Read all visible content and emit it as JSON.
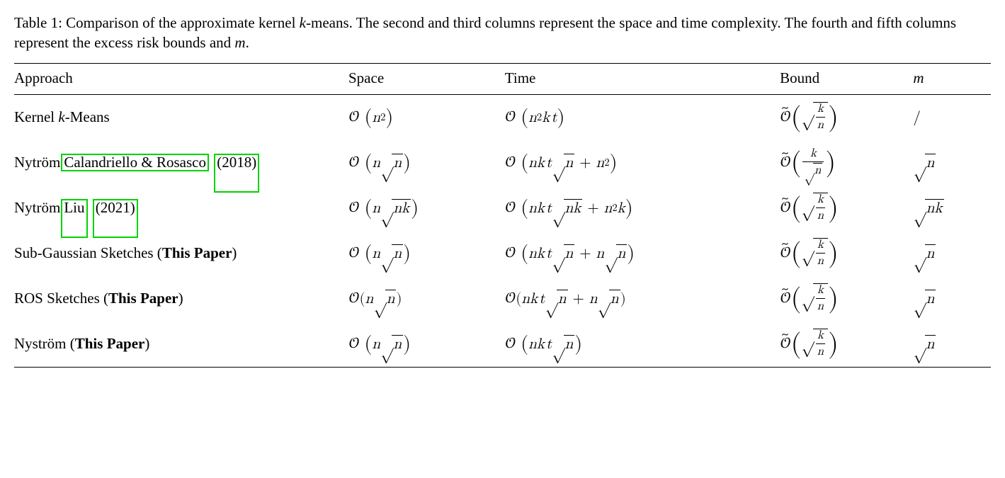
{
  "caption": {
    "label": "Table 1:",
    "text_before_k": " Comparison of the approximate kernel ",
    "k": "k",
    "text_mid": "-means. The second and third columns represent the space and time complexity. The fourth and fifth columns represent the excess risk bounds and ",
    "m": "m",
    "period": "."
  },
  "headers": {
    "approach": "Approach",
    "space": "Space",
    "time": "Time",
    "bound": "Bound",
    "m": "m"
  },
  "rows": [
    {
      "approach": {
        "prefix": "Kernel ",
        "k": "k",
        "suffix": "-Means"
      },
      "space": "O(n^2)",
      "time": "O(n^2 k t)",
      "bound": "Õ(√(k/n))",
      "m": "/"
    },
    {
      "approach": {
        "prefix": "Nytröm",
        "cite_authors": "Calandriello & Rosasco",
        "cite_year": "2018"
      },
      "space": "O(n√n)",
      "time": "O(nkt√n + n^2)",
      "bound": "Õ(k/√n)",
      "m": "√n"
    },
    {
      "approach": {
        "prefix": "Nytröm",
        "cite_authors": "Liu",
        "cite_year": "2021"
      },
      "space": "O(n√(nk))",
      "time": "O(nkt√(nk) + n^2 k)",
      "bound": "Õ(√(k/n))",
      "m": "√(nk)"
    },
    {
      "approach": {
        "prefix": "Sub-Gaussian Sketches (",
        "bold": "This Paper",
        "suffix": ")"
      },
      "space": "O(n√n)",
      "time": "O(nkt√n + n√n)",
      "bound": "Õ(√(k/n))",
      "m": "√n"
    },
    {
      "approach": {
        "prefix": "ROS Sketches (",
        "bold": "This Paper",
        "suffix": ")"
      },
      "space": "O(n√n)",
      "time": "O(nkt√n + n√n)",
      "bound": "Õ(√(k/n))",
      "m": "√n"
    },
    {
      "approach": {
        "prefix": "Nyström (",
        "bold": "This Paper",
        "suffix": ")"
      },
      "space": "O(n√n)",
      "time": "O(nkt√n)",
      "bound": "Õ(√(k/n))",
      "m": "√n"
    }
  ],
  "chart_data": {
    "type": "table",
    "title": "Comparison of the approximate kernel k-means",
    "columns": [
      "Approach",
      "Space",
      "Time",
      "Bound",
      "m"
    ],
    "rows": [
      [
        "Kernel k-Means",
        "O(n^2)",
        "O(n^2 k t)",
        "Õ(√(k/n))",
        "/"
      ],
      [
        "Nytröm Calandriello & Rosasco (2018)",
        "O(n√n)",
        "O(nkt√n + n^2)",
        "Õ(k/√n)",
        "√n"
      ],
      [
        "Nytröm Liu (2021)",
        "O(n√(nk))",
        "O(nkt√(nk) + n^2 k)",
        "Õ(√(k/n))",
        "√(nk)"
      ],
      [
        "Sub-Gaussian Sketches (This Paper)",
        "O(n√n)",
        "O(nkt√n + n√n)",
        "Õ(√(k/n))",
        "√n"
      ],
      [
        "ROS Sketches (This Paper)",
        "O(n√n)",
        "O(nkt√n + n√n)",
        "Õ(√(k/n))",
        "√n"
      ],
      [
        "Nyström (This Paper)",
        "O(n√n)",
        "O(nkt√n)",
        "Õ(√(k/n))",
        "√n"
      ]
    ]
  }
}
